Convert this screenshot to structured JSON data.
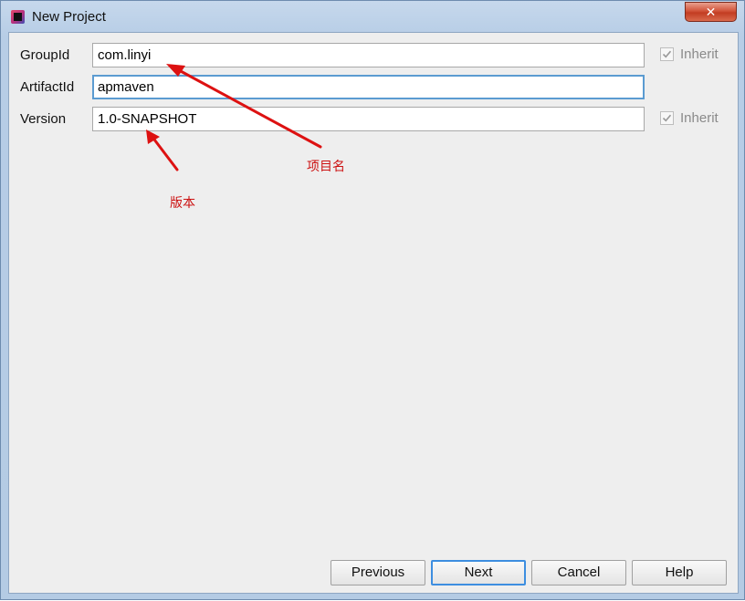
{
  "window": {
    "title": "New Project",
    "close_glyph": "✕"
  },
  "form": {
    "group_id": {
      "label": "GroupId",
      "value": "com.linyi",
      "inherit_label": "Inherit",
      "inherit_checked": true
    },
    "artifact_id": {
      "label": "ArtifactId",
      "value": "apmaven"
    },
    "version": {
      "label": "Version",
      "value": "1.0-SNAPSHOT",
      "inherit_label": "Inherit",
      "inherit_checked": true
    }
  },
  "annotations": {
    "project_name": "项目名",
    "version_note": "版本",
    "color": "#dd1111"
  },
  "buttons": {
    "previous": "Previous",
    "next": "Next",
    "cancel": "Cancel",
    "help": "Help"
  },
  "colors": {
    "focus_border": "#5b9bd1",
    "default_button_border": "#3d8ee0",
    "close_button": "#c23c22"
  }
}
